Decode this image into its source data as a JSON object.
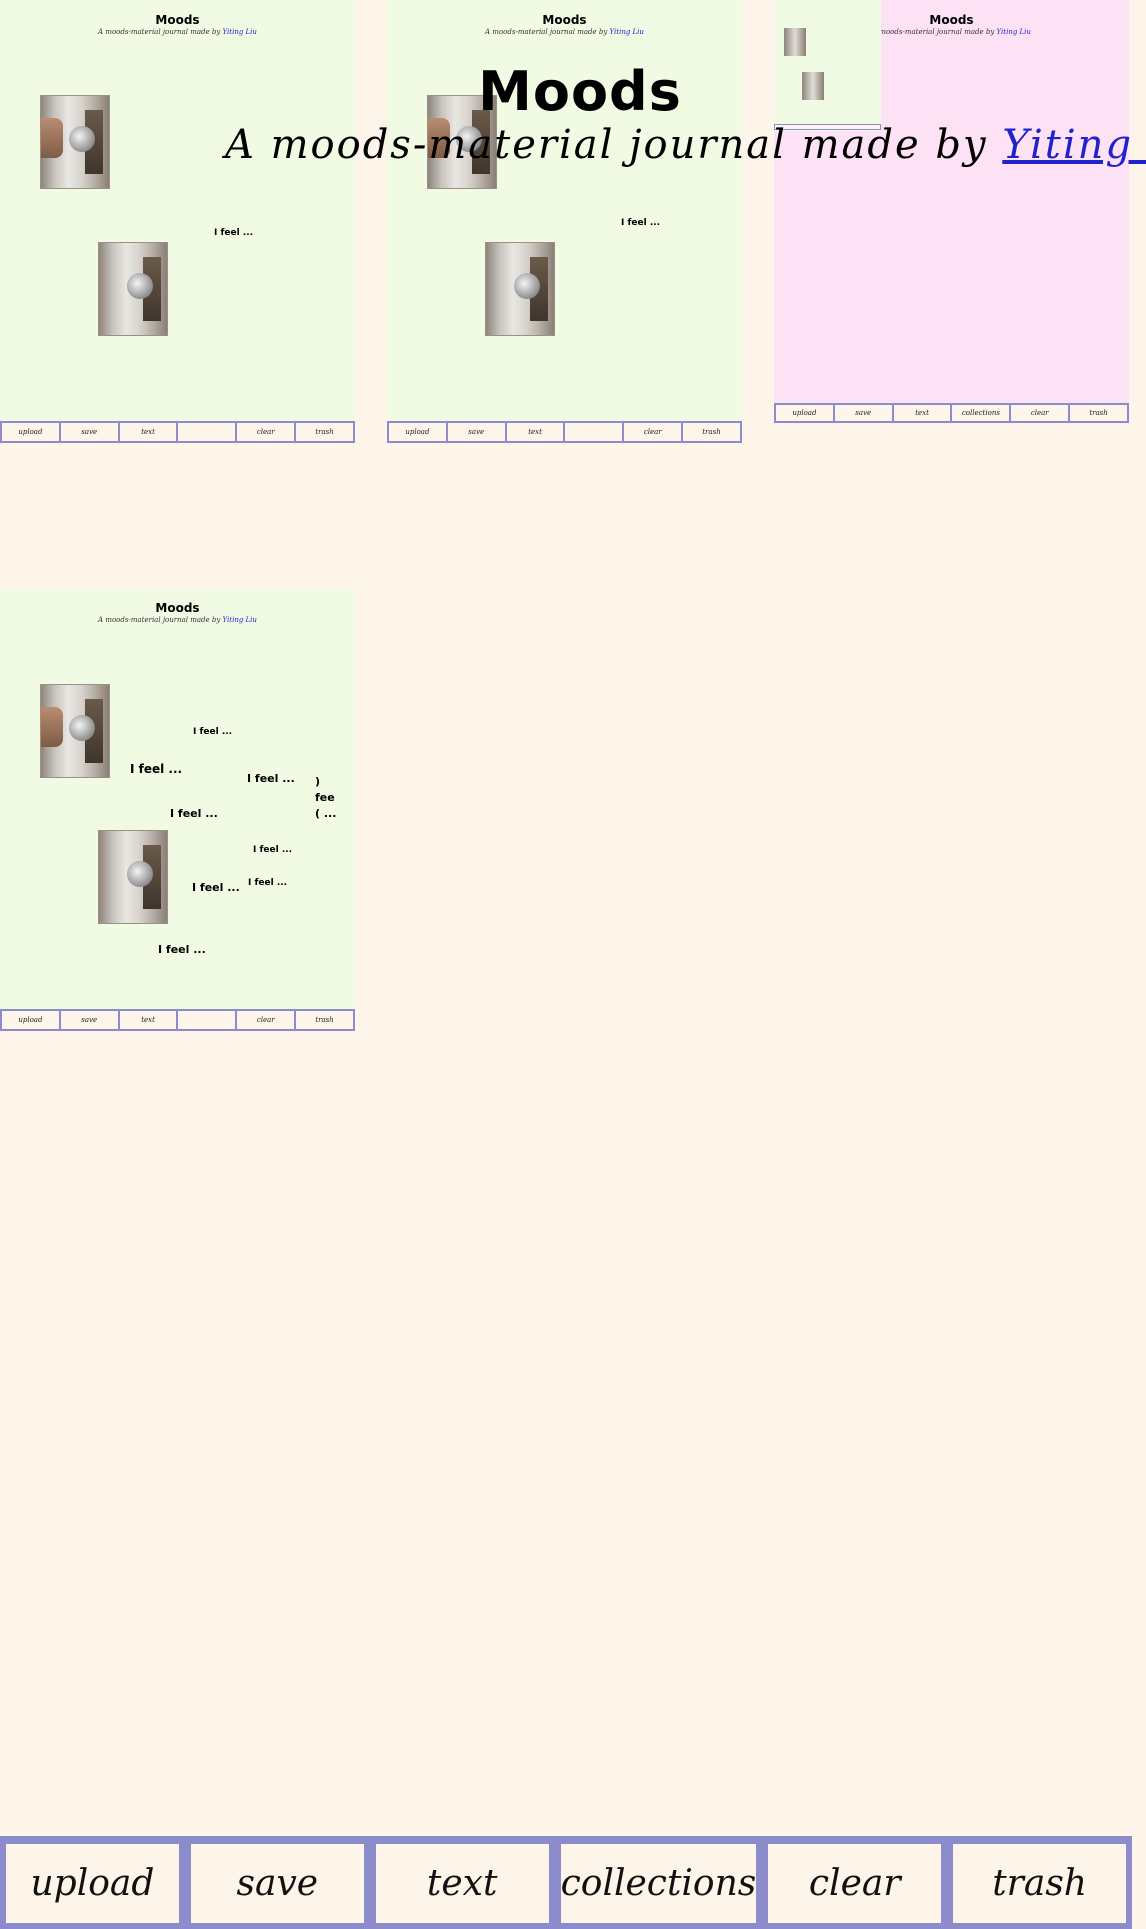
{
  "header": {
    "title": "Moods",
    "subtitle_prefix": "A moods-material journal made by ",
    "author_link": "Yiting Liu"
  },
  "thumb": {
    "title": "Moods",
    "subtitle_prefix": "A moods-material journal made by ",
    "author_link": "Yiting Liu"
  },
  "feel_text": "I feel ...",
  "partial_feel": {
    "line1": ")",
    "line2": "fee",
    "line3": "( ..."
  },
  "thumb_toolbar_a": [
    "upload",
    "save",
    "text",
    "",
    "clear",
    "trash"
  ],
  "thumb_toolbar_b": [
    "upload",
    "save",
    "text",
    "collections",
    "clear",
    "trash"
  ],
  "toolbar": {
    "upload": "upload",
    "save": "save",
    "text": "text",
    "collections": "collections",
    "clear": "clear",
    "trash": "trash"
  },
  "colors": {
    "background": "#fdf4ea",
    "journal_green": "#f1fae3",
    "journal_pink": "#fce2f4",
    "toolbar_border": "#8c8ccd",
    "link": "#2222cc"
  }
}
